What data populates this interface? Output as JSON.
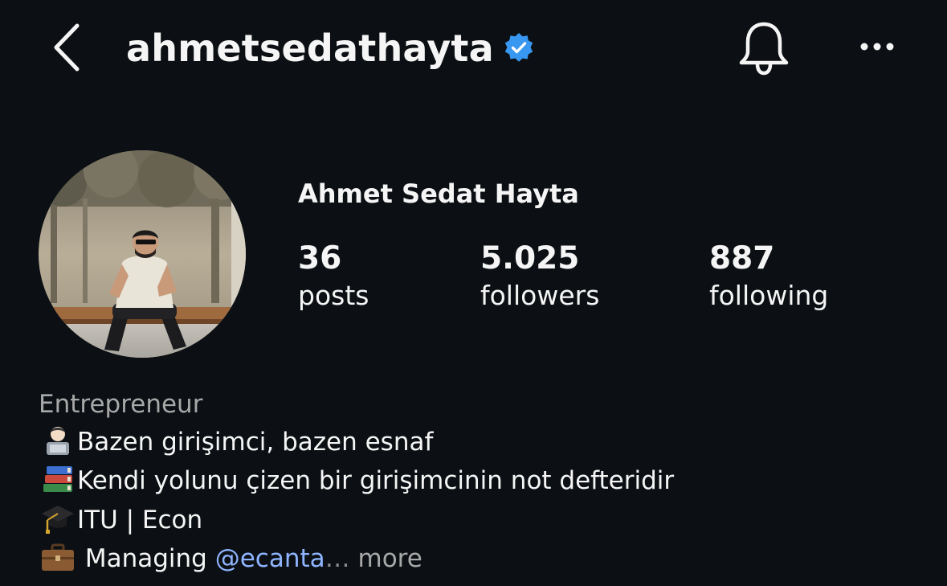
{
  "header": {
    "username": "ahmetsedathayta",
    "verified_color": "#3897f0",
    "icons": [
      "chevron-left-icon",
      "verified-badge-icon",
      "bell-icon",
      "more-horizontal-icon"
    ]
  },
  "profile": {
    "full_name": "Ahmet Sedat Hayta",
    "stats": {
      "posts": {
        "value": "36",
        "label": "posts"
      },
      "followers": {
        "value": "5.025",
        "label": "followers"
      },
      "following": {
        "value": "887",
        "label": "following"
      }
    }
  },
  "bio": {
    "category": "Entrepreneur",
    "line1": "Bazen girişimci, bazen esnaf",
    "line2": "Kendi yolunu çizen bir girişimcinin not defteridir",
    "line3": "ITU | Econ",
    "line4_text": " Managing ",
    "line4_mention": "@ecanta",
    "line4_ellipsis": "…",
    "more_label": " more",
    "emojis": [
      "technologist-emoji",
      "books-emoji",
      "graduation-cap-emoji",
      "briefcase-emoji"
    ]
  },
  "colors": {
    "background": "#0c1014",
    "text": "#f5f5f5",
    "secondary_text": "#a8a8a8",
    "mention": "#8fb4ff"
  }
}
